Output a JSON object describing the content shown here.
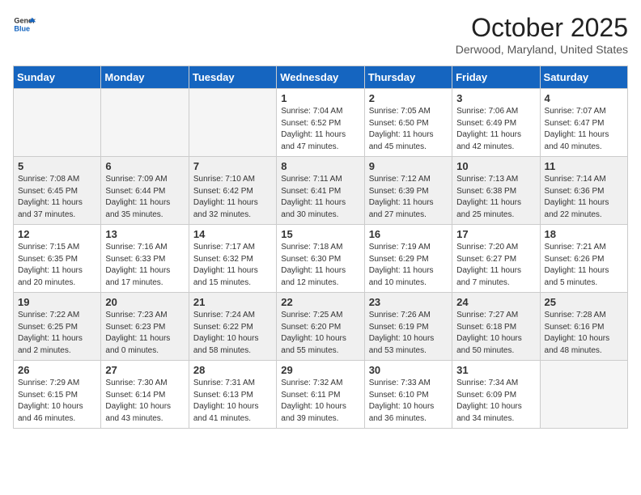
{
  "logo": {
    "line1": "General",
    "line2": "Blue"
  },
  "title": "October 2025",
  "subtitle": "Derwood, Maryland, United States",
  "days_header": [
    "Sunday",
    "Monday",
    "Tuesday",
    "Wednesday",
    "Thursday",
    "Friday",
    "Saturday"
  ],
  "weeks": [
    [
      {
        "num": "",
        "info": ""
      },
      {
        "num": "",
        "info": ""
      },
      {
        "num": "",
        "info": ""
      },
      {
        "num": "1",
        "info": "Sunrise: 7:04 AM\nSunset: 6:52 PM\nDaylight: 11 hours\nand 47 minutes."
      },
      {
        "num": "2",
        "info": "Sunrise: 7:05 AM\nSunset: 6:50 PM\nDaylight: 11 hours\nand 45 minutes."
      },
      {
        "num": "3",
        "info": "Sunrise: 7:06 AM\nSunset: 6:49 PM\nDaylight: 11 hours\nand 42 minutes."
      },
      {
        "num": "4",
        "info": "Sunrise: 7:07 AM\nSunset: 6:47 PM\nDaylight: 11 hours\nand 40 minutes."
      }
    ],
    [
      {
        "num": "5",
        "info": "Sunrise: 7:08 AM\nSunset: 6:45 PM\nDaylight: 11 hours\nand 37 minutes."
      },
      {
        "num": "6",
        "info": "Sunrise: 7:09 AM\nSunset: 6:44 PM\nDaylight: 11 hours\nand 35 minutes."
      },
      {
        "num": "7",
        "info": "Sunrise: 7:10 AM\nSunset: 6:42 PM\nDaylight: 11 hours\nand 32 minutes."
      },
      {
        "num": "8",
        "info": "Sunrise: 7:11 AM\nSunset: 6:41 PM\nDaylight: 11 hours\nand 30 minutes."
      },
      {
        "num": "9",
        "info": "Sunrise: 7:12 AM\nSunset: 6:39 PM\nDaylight: 11 hours\nand 27 minutes."
      },
      {
        "num": "10",
        "info": "Sunrise: 7:13 AM\nSunset: 6:38 PM\nDaylight: 11 hours\nand 25 minutes."
      },
      {
        "num": "11",
        "info": "Sunrise: 7:14 AM\nSunset: 6:36 PM\nDaylight: 11 hours\nand 22 minutes."
      }
    ],
    [
      {
        "num": "12",
        "info": "Sunrise: 7:15 AM\nSunset: 6:35 PM\nDaylight: 11 hours\nand 20 minutes."
      },
      {
        "num": "13",
        "info": "Sunrise: 7:16 AM\nSunset: 6:33 PM\nDaylight: 11 hours\nand 17 minutes."
      },
      {
        "num": "14",
        "info": "Sunrise: 7:17 AM\nSunset: 6:32 PM\nDaylight: 11 hours\nand 15 minutes."
      },
      {
        "num": "15",
        "info": "Sunrise: 7:18 AM\nSunset: 6:30 PM\nDaylight: 11 hours\nand 12 minutes."
      },
      {
        "num": "16",
        "info": "Sunrise: 7:19 AM\nSunset: 6:29 PM\nDaylight: 11 hours\nand 10 minutes."
      },
      {
        "num": "17",
        "info": "Sunrise: 7:20 AM\nSunset: 6:27 PM\nDaylight: 11 hours\nand 7 minutes."
      },
      {
        "num": "18",
        "info": "Sunrise: 7:21 AM\nSunset: 6:26 PM\nDaylight: 11 hours\nand 5 minutes."
      }
    ],
    [
      {
        "num": "19",
        "info": "Sunrise: 7:22 AM\nSunset: 6:25 PM\nDaylight: 11 hours\nand 2 minutes."
      },
      {
        "num": "20",
        "info": "Sunrise: 7:23 AM\nSunset: 6:23 PM\nDaylight: 11 hours\nand 0 minutes."
      },
      {
        "num": "21",
        "info": "Sunrise: 7:24 AM\nSunset: 6:22 PM\nDaylight: 10 hours\nand 58 minutes."
      },
      {
        "num": "22",
        "info": "Sunrise: 7:25 AM\nSunset: 6:20 PM\nDaylight: 10 hours\nand 55 minutes."
      },
      {
        "num": "23",
        "info": "Sunrise: 7:26 AM\nSunset: 6:19 PM\nDaylight: 10 hours\nand 53 minutes."
      },
      {
        "num": "24",
        "info": "Sunrise: 7:27 AM\nSunset: 6:18 PM\nDaylight: 10 hours\nand 50 minutes."
      },
      {
        "num": "25",
        "info": "Sunrise: 7:28 AM\nSunset: 6:16 PM\nDaylight: 10 hours\nand 48 minutes."
      }
    ],
    [
      {
        "num": "26",
        "info": "Sunrise: 7:29 AM\nSunset: 6:15 PM\nDaylight: 10 hours\nand 46 minutes."
      },
      {
        "num": "27",
        "info": "Sunrise: 7:30 AM\nSunset: 6:14 PM\nDaylight: 10 hours\nand 43 minutes."
      },
      {
        "num": "28",
        "info": "Sunrise: 7:31 AM\nSunset: 6:13 PM\nDaylight: 10 hours\nand 41 minutes."
      },
      {
        "num": "29",
        "info": "Sunrise: 7:32 AM\nSunset: 6:11 PM\nDaylight: 10 hours\nand 39 minutes."
      },
      {
        "num": "30",
        "info": "Sunrise: 7:33 AM\nSunset: 6:10 PM\nDaylight: 10 hours\nand 36 minutes."
      },
      {
        "num": "31",
        "info": "Sunrise: 7:34 AM\nSunset: 6:09 PM\nDaylight: 10 hours\nand 34 minutes."
      },
      {
        "num": "",
        "info": ""
      }
    ]
  ]
}
